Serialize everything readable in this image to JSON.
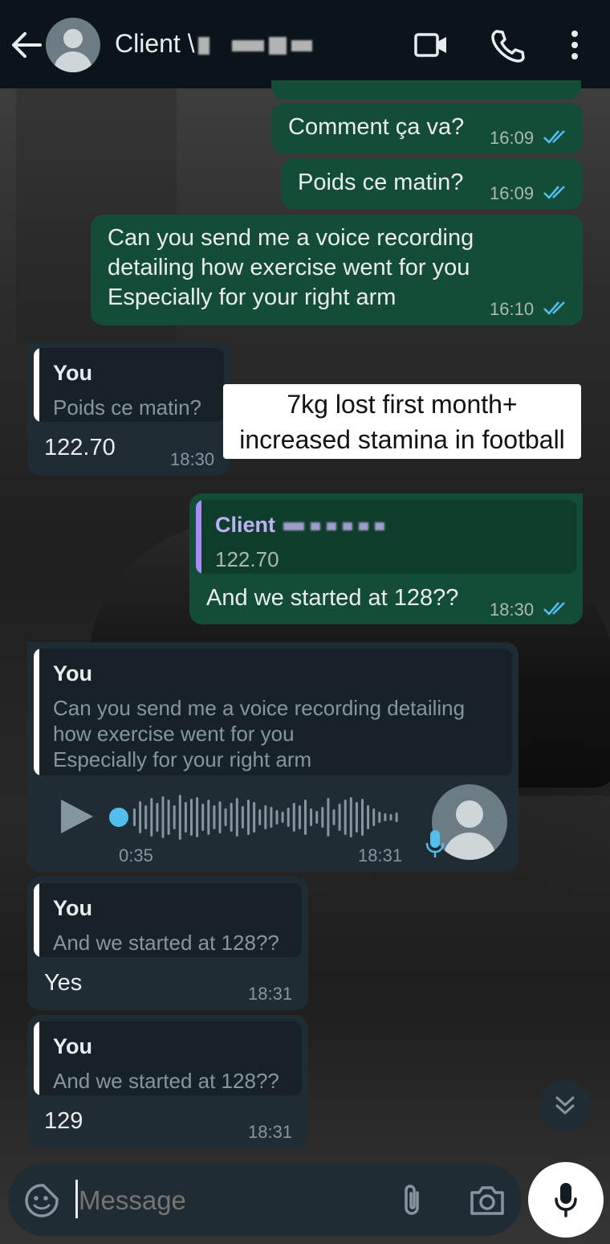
{
  "header": {
    "contact_name": "Client \\",
    "icons": [
      "back-arrow-icon",
      "avatar",
      "video-call-icon",
      "phone-icon",
      "more-options-icon"
    ]
  },
  "messages": {
    "m1": {
      "text": "Comment ça va?",
      "time": "16:09"
    },
    "m2": {
      "text": "Poids ce matin?",
      "time": "16:09"
    },
    "m3": {
      "text": "Can you send me a voice recording\ndetailing how exercise went for you\nEspecially  for your right arm",
      "time": "16:10"
    },
    "m4": {
      "quote_name": "You",
      "quote_text": "Poids ce matin?",
      "text": "122.70",
      "time": "18:30"
    },
    "m5": {
      "quote_name": "Client",
      "quote_text": "122.70",
      "text": "And we started at 128??",
      "time": "18:30"
    },
    "m6": {
      "quote_name": "You",
      "quote_text": "Can you send me a voice recording detailing\nhow exercise went for you\nEspecially  for your right arm",
      "duration": "0:35",
      "time": "18:31"
    },
    "m7": {
      "quote_name": "You",
      "quote_text": "And we started at 128??",
      "text": "Yes",
      "time": "18:31"
    },
    "m8": {
      "quote_name": "You",
      "quote_text": "And we started at 128??",
      "text": "129",
      "time": "18:31"
    }
  },
  "annotation": {
    "line1": "7kg lost first month+",
    "line2": "increased stamina in football"
  },
  "input": {
    "placeholder": "Message"
  },
  "colors": {
    "outgoing": "#144d37",
    "incoming": "#1f2c33",
    "tick_read": "#53bdeb",
    "accent_quote": "#a88cf5"
  }
}
